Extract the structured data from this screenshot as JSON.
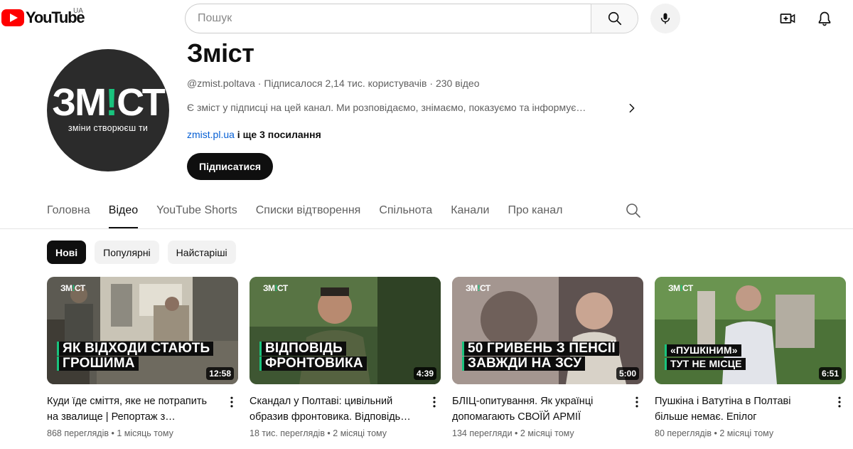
{
  "header": {
    "logo_text": "YouTube",
    "region": "UA",
    "search_placeholder": "Пошук"
  },
  "channel": {
    "name": "Зміст",
    "avatar_title_pre": "ЗМ",
    "avatar_title_excl": "!",
    "avatar_title_post": "СТ",
    "avatar_subtitle": "зміни створюєш ти",
    "handle": "@zmist.poltava",
    "subscribers": "Підписалося 2,14 тис. користувачів",
    "video_count": "230 відео",
    "separator": " · ",
    "description": "Є зміст у підписці на цей канал. Ми розповідаємо, знімаємо, показуємо та інформує…",
    "link": "zmist.pl.ua",
    "more_links": " і ще 3 посилання",
    "subscribe_label": "Підписатися"
  },
  "tabs": [
    {
      "label": "Головна",
      "active": false
    },
    {
      "label": "Відео",
      "active": true
    },
    {
      "label": "YouTube Shorts",
      "active": false
    },
    {
      "label": "Списки відтворення",
      "active": false
    },
    {
      "label": "Спільнота",
      "active": false
    },
    {
      "label": "Канали",
      "active": false
    },
    {
      "label": "Про канал",
      "active": false
    }
  ],
  "chips": [
    {
      "label": "Нові",
      "active": true
    },
    {
      "label": "Популярні",
      "active": false
    },
    {
      "label": "Найстаріші",
      "active": false
    }
  ],
  "videos": [
    {
      "thumb_logo_pre": "ЗМ",
      "thumb_logo_excl": "!",
      "thumb_logo_post": "СТ",
      "caption_line1": "ЯК ВІДХОДИ СТАЮТЬ",
      "caption_line2": "ГРОШИМА",
      "duration": "12:58",
      "title": "Куди їде сміття, яке не потрапить на звалище | Репортаж з…",
      "meta": "868 переглядів • 1 місяць тому",
      "palette": [
        "#6b6a63",
        "#b8b2a2",
        "#4d4a42"
      ]
    },
    {
      "thumb_logo_pre": "ЗМ",
      "thumb_logo_excl": "!",
      "thumb_logo_post": "СТ",
      "caption_line1": "ВІДПОВІДЬ",
      "caption_line2": "ФРОНТОВИКА",
      "duration": "4:39",
      "title": "Скандал у Полтаві: цивільний образив фронтовика. Відповідь…",
      "meta": "18 тис. переглядів • 2 місяці тому",
      "palette": [
        "#3f5a33",
        "#6c7d4b",
        "#2e3a26"
      ]
    },
    {
      "thumb_logo_pre": "ЗМ",
      "thumb_logo_excl": "!",
      "thumb_logo_post": "СТ",
      "caption_line1": "50 ГРИВЕНЬ З ПЕНСІЇ",
      "caption_line2": "ЗАВЖДИ НА ЗСУ",
      "duration": "5:00",
      "title": "БЛІЦ-опитування. Як українці допомагають СВОЇЙ АРМІЇ",
      "meta": "134 перегляди • 2 місяці тому",
      "palette": [
        "#8a7d78",
        "#c9bdb5",
        "#5b504d"
      ]
    },
    {
      "thumb_logo_pre": "ЗМ",
      "thumb_logo_excl": "!",
      "thumb_logo_post": "СТ",
      "caption_line1": "«ПУШКІНИМ»",
      "caption_line2": "ТУТ НЕ МІСЦЕ",
      "duration": "6:51",
      "title": "Пушкіна і Ватутіна в Полтаві більше немає. Епілог",
      "meta": "80 переглядів • 2 місяці тому",
      "palette": [
        "#4f7a3c",
        "#b8b3a8",
        "#345224"
      ]
    }
  ]
}
